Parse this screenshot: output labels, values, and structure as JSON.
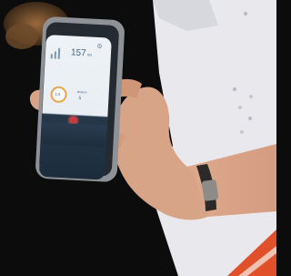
{
  "scene": {
    "description_free_photo": true,
    "colors": {
      "background_dark": "#0d0c0c",
      "paper": "#e9e9ed",
      "skin": "#d8a487",
      "phone_body": "#8e9297",
      "screen_light": "#eef2f6",
      "screen_dark": "#1c2c3c",
      "accent_ring": "#e8a54e",
      "accent_red": "#c63b3b",
      "poster_red": "#e0502a",
      "bracelet": "#2b2a29"
    }
  },
  "phone_screen": {
    "gauge_value": "157",
    "gauge_unit": "ms",
    "ring_value": "1:4",
    "card_label": "Medium",
    "card_value": "5",
    "button_left": "",
    "button_right": "",
    "bar_levels": [
      0.45,
      0.7,
      1.0
    ],
    "icons": [
      "bar-chart-icon",
      "settings-icon",
      "record-icon"
    ]
  }
}
